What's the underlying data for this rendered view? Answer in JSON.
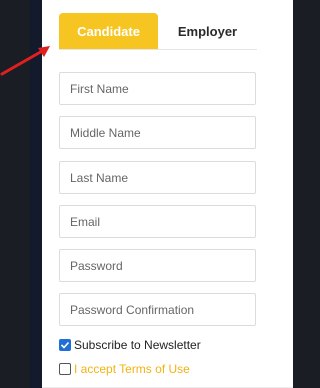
{
  "tabs": {
    "candidate": "Candidate",
    "employer": "Employer",
    "active": "Candidate"
  },
  "fields": {
    "first_name": {
      "placeholder": "First Name",
      "value": ""
    },
    "middle_name": {
      "placeholder": "Middle Name",
      "value": ""
    },
    "last_name": {
      "placeholder": "Last Name",
      "value": ""
    },
    "email": {
      "placeholder": "Email",
      "value": ""
    },
    "password": {
      "placeholder": "Password",
      "value": ""
    },
    "password_confirmation": {
      "placeholder": "Password Confirmation",
      "value": ""
    }
  },
  "checkboxes": {
    "newsletter": {
      "label": "Subscribe to Newsletter",
      "checked": true
    },
    "terms": {
      "label": "I accept Terms of Use",
      "checked": false
    }
  },
  "colors": {
    "accent": "#f7c522",
    "terms_link": "#f2b312",
    "checkbox": "#1f6fd6",
    "annotation_arrow": "#e02020",
    "page_background": "#1a1d24"
  },
  "icons": {
    "annotation": "red-arrow-icon",
    "check": "checkmark-icon"
  }
}
